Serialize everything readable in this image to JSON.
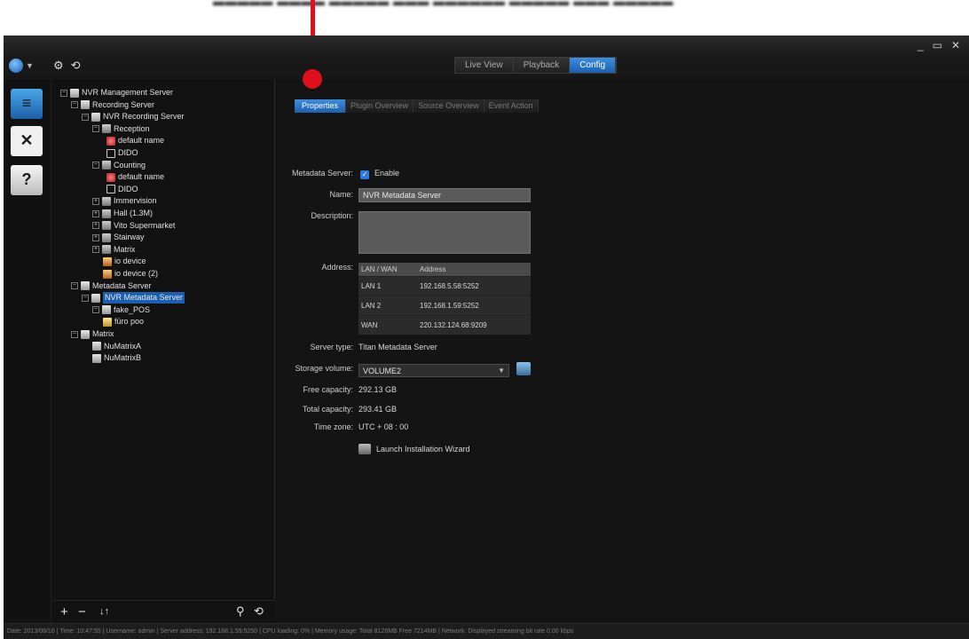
{
  "window": {
    "controls": [
      "_",
      "▭",
      "✕"
    ]
  },
  "mode_tabs": [
    {
      "label": "Live View",
      "active": false
    },
    {
      "label": "Playback",
      "active": false
    },
    {
      "label": "Config",
      "active": true
    }
  ],
  "tree": {
    "nodes": [
      {
        "label": "NVR Management Server",
        "icon": "server-icon",
        "expander": "⊟"
      },
      {
        "label": "Recording Server",
        "icon": "server-icon",
        "expander": "⊟"
      },
      {
        "label": "NVR Recording Server",
        "icon": "server-icon",
        "expander": "⊟"
      },
      {
        "label": "Reception",
        "icon": "group-icon",
        "expander": "⊟"
      },
      {
        "label": "default name",
        "icon": "camera-icon",
        "expander": ""
      },
      {
        "label": "DIDO",
        "icon": "dido-icon",
        "expander": ""
      },
      {
        "label": "Counting",
        "icon": "group-icon",
        "expander": "⊟"
      },
      {
        "label": "default name",
        "icon": "camera-icon",
        "expander": ""
      },
      {
        "label": "DIDO",
        "icon": "dido-icon",
        "expander": ""
      },
      {
        "label": "Immervision",
        "icon": "group-icon",
        "expander": "⊞"
      },
      {
        "label": "Hall (1.3M)",
        "icon": "group-icon",
        "expander": "⊞"
      },
      {
        "label": "Vito Supermarket",
        "icon": "group-icon",
        "expander": "⊞"
      },
      {
        "label": "Stairway",
        "icon": "group-icon",
        "expander": "⊞"
      },
      {
        "label": "Matrix",
        "icon": "group-icon",
        "expander": "⊞"
      },
      {
        "label": "io device",
        "icon": "io-device-icon",
        "expander": ""
      },
      {
        "label": "io device (2)",
        "icon": "io-device-icon",
        "expander": ""
      },
      {
        "label": "Metadata Server",
        "icon": "server-icon",
        "expander": "⊟"
      },
      {
        "label": "NVR Metadata Server",
        "icon": "server-icon",
        "expander": "⊟",
        "selected": true
      },
      {
        "label": "fake_POS",
        "icon": "pos-icon",
        "expander": "⊟"
      },
      {
        "label": "füro poo",
        "icon": "metadata-icon",
        "expander": ""
      },
      {
        "label": "Matrix",
        "icon": "server-icon",
        "expander": "⊟"
      },
      {
        "label": "NuMatrixA",
        "icon": "server-icon",
        "expander": ""
      },
      {
        "label": "NuMatrixB",
        "icon": "server-icon",
        "expander": ""
      }
    ]
  },
  "tree_footer": {
    "add": "+",
    "remove": "−",
    "sort": "↓↑",
    "search": "⚲",
    "refresh": "⟲"
  },
  "sub_tabs": [
    {
      "label": "Properties",
      "active": true
    },
    {
      "label": "Plugin Overview",
      "active": false
    },
    {
      "label": "Source Overview",
      "active": false
    },
    {
      "label": "Event Action",
      "active": false
    }
  ],
  "form": {
    "metadata_server_label": "Metadata Server:",
    "enable_label": "Enable",
    "name_label": "Name:",
    "name_value": "NVR Metadata Server",
    "description_label": "Description:",
    "address_label": "Address:",
    "address_table": {
      "headers": [
        "LAN / WAN",
        "Address"
      ],
      "rows": [
        [
          "LAN 1",
          "192.168.5.58:5252"
        ],
        [
          "LAN 2",
          "192.168.1.59:5252"
        ],
        [
          "WAN",
          "220.132.124.68:9209"
        ]
      ]
    },
    "server_type_label": "Server type:",
    "server_type_value": "Titan Metadata Server",
    "storage_volume_label": "Storage volume:",
    "storage_volume_value": "VOLUME2",
    "free_capacity_label": "Free capacity:",
    "free_capacity_value": "292.13 GB",
    "total_capacity_label": "Total capacity:",
    "total_capacity_value": "293.41 GB",
    "time_zone_label": "Time zone:",
    "time_zone_value": "UTC + 08 : 00",
    "wizard_label": "Launch Installation Wizard"
  },
  "status_bar": "Date: 2013/08/16  |  Time: 10:47:55  |  Username: admin  |  Server address: 192.168.1.59:5250  |  CPU loading: 0%  |  Memory usage: Total 8126MB Free 7214MB  |  Network: Displayed streaming bit rate   0.00 kbps",
  "colors": {
    "accent_blue": "#2a7be0",
    "annotation_red": "#e0101a",
    "background": "#141414"
  }
}
